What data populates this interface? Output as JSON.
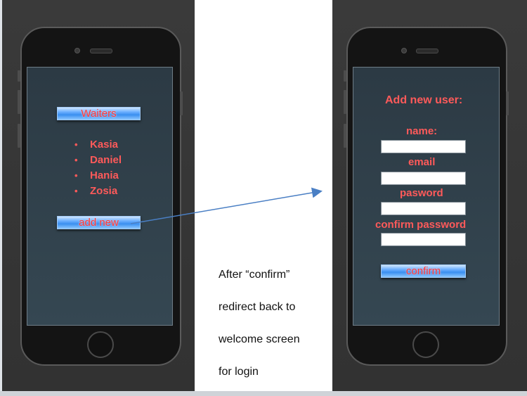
{
  "left_screen": {
    "header_button": "Waiters",
    "waiters": [
      "Kasia",
      "Daniel",
      "Hania",
      "Zosia"
    ],
    "add_button": "add new",
    "bullet": "•"
  },
  "right_screen": {
    "title": "Add new user:",
    "name_label": "name:",
    "email_label": "email",
    "password_label": "pasword",
    "confirm_password_label": "confirm password",
    "confirm_button": "confirm",
    "name_value": "",
    "email_value": "",
    "password_value": "",
    "confirm_password_value": ""
  },
  "note": {
    "line1": "After “confirm”",
    "line2": "redirect back to",
    "line3": "welcome screen",
    "line4": "for login"
  },
  "colors": {
    "label_red": "#ff5a5a",
    "button_blue": "#3a8ff0",
    "arrow_blue": "#4a7fc4",
    "panel_dark": "#353535"
  }
}
